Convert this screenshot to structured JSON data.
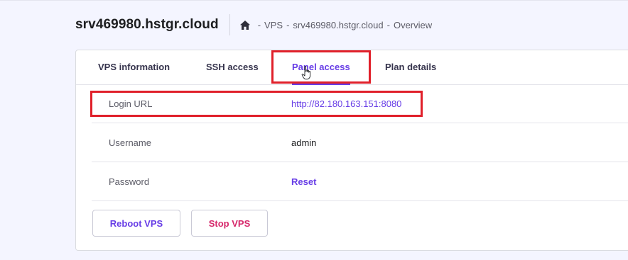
{
  "header": {
    "title": "srv469980.hstgr.cloud",
    "breadcrumb": [
      {
        "label": "VPS"
      },
      {
        "label": "srv469980.hstgr.cloud"
      },
      {
        "label": "Overview"
      }
    ],
    "breadcrumb_separator": "-"
  },
  "tabs": [
    {
      "label": "VPS information",
      "active": false
    },
    {
      "label": "SSH access",
      "active": false
    },
    {
      "label": "Panel access",
      "active": true
    },
    {
      "label": "Plan details",
      "active": false
    }
  ],
  "rows": [
    {
      "label": "Login URL",
      "value": "http://82.180.163.151:8080"
    },
    {
      "label": "Username",
      "value": "admin"
    },
    {
      "label": "Password",
      "value": "Reset"
    }
  ],
  "buttons": {
    "reboot": "Reboot VPS",
    "stop": "Stop VPS"
  },
  "colors": {
    "accent": "#673de6",
    "danger": "#d6286b",
    "highlight": "#e0202a"
  },
  "icons": {
    "home": "home-icon",
    "cursor": "hand-pointer-icon"
  }
}
